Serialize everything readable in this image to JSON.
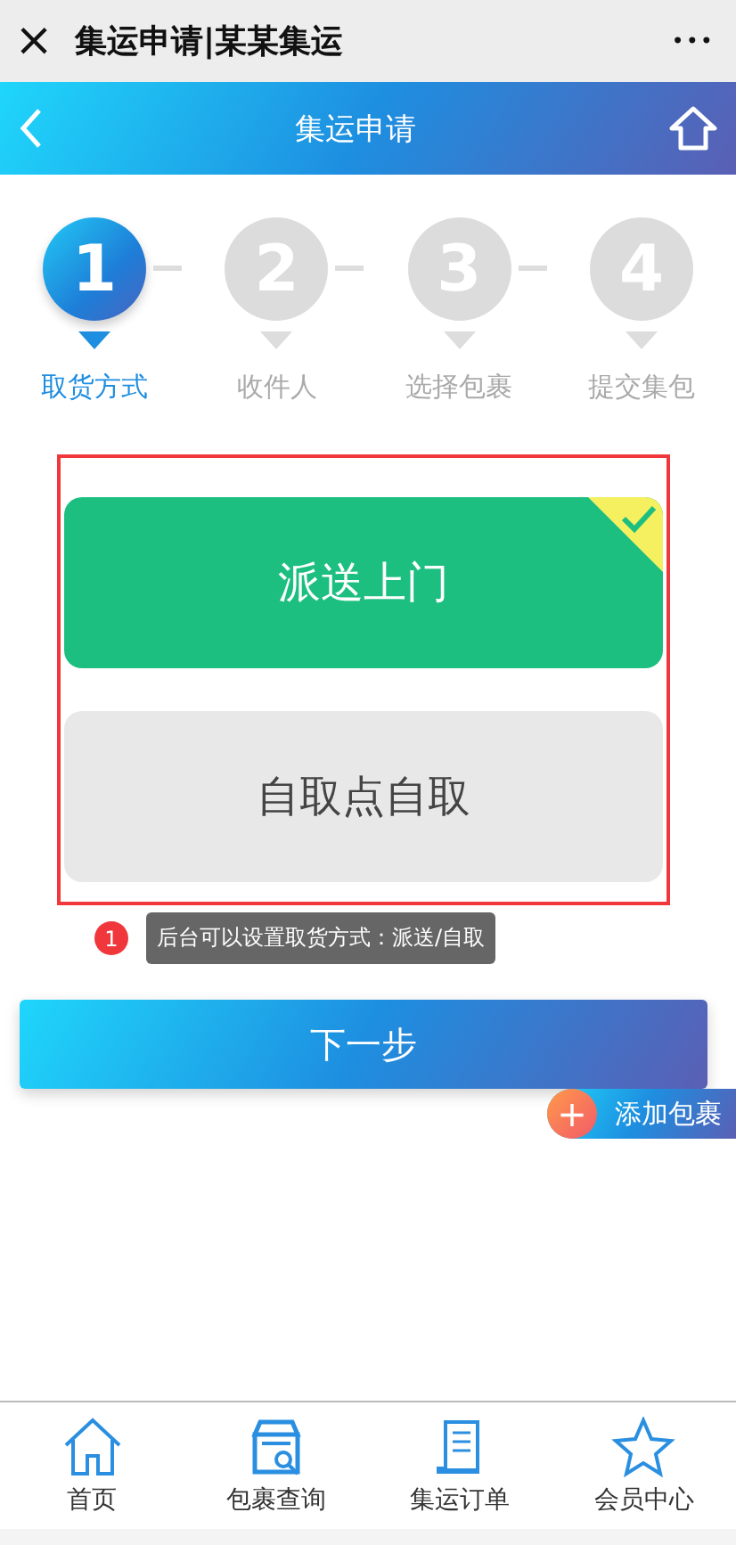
{
  "window": {
    "title": "集运申请|某某集运",
    "close": "×",
    "more": "•••"
  },
  "header": {
    "title": "集运申请"
  },
  "steps": [
    {
      "number": "1",
      "label": "取货方式",
      "selected": true
    },
    {
      "number": "2",
      "label": "收件人",
      "selected": false
    },
    {
      "number": "3",
      "label": "选择包裹",
      "selected": false
    },
    {
      "number": "4",
      "label": "提交集包",
      "selected": false
    }
  ],
  "options": [
    {
      "label": "派送上门",
      "selected": true
    },
    {
      "label": "自取点自取",
      "selected": false
    }
  ],
  "annotation": {
    "badge": "1",
    "text": "后台可以设置取货方式：派送/自取"
  },
  "next_button": "下一步",
  "add_package": {
    "icon": "+",
    "label": "添加包裹"
  },
  "nav": [
    {
      "kind": "home",
      "label": "首页"
    },
    {
      "kind": "parcel",
      "label": "包裹查询"
    },
    {
      "kind": "order",
      "label": "集运订单"
    },
    {
      "kind": "member",
      "label": "会员中心"
    }
  ]
}
